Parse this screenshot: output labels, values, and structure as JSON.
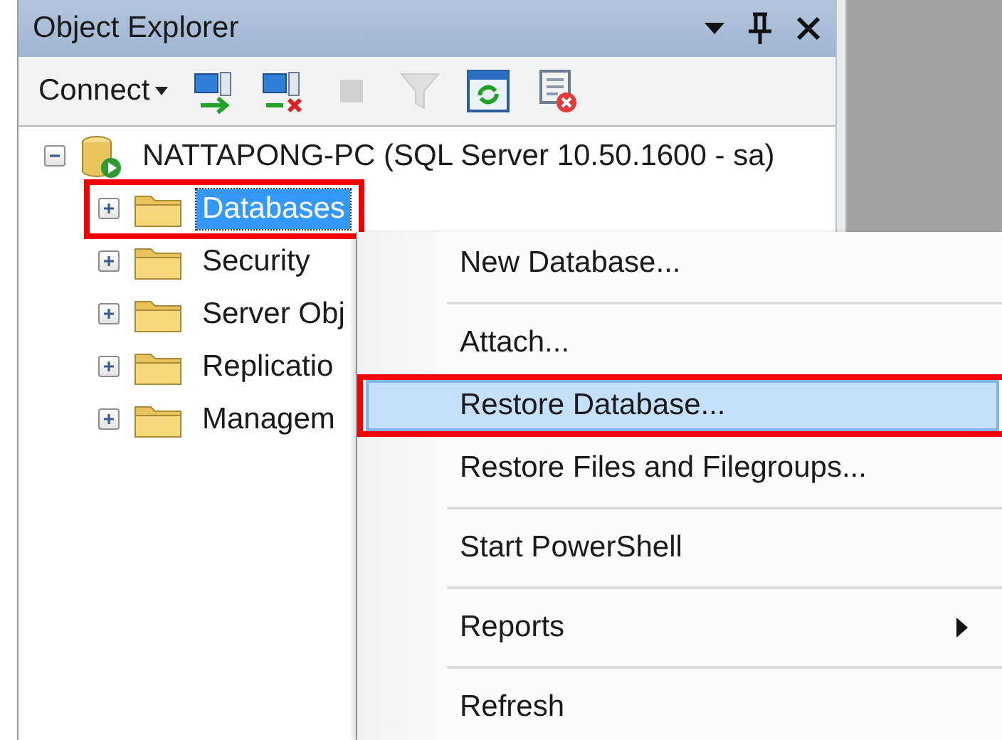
{
  "panel": {
    "title": "Object Explorer"
  },
  "toolbar": {
    "connect": {
      "label": "Connect"
    },
    "buttons": [
      {
        "disabled": false
      },
      {
        "disabled": false
      },
      {
        "disabled": true
      },
      {
        "disabled": true
      },
      {
        "disabled": false
      },
      {
        "disabled": false
      }
    ]
  },
  "tree": {
    "label": "NATTAPONG-PC (SQL Server 10.50.1600 - sa)",
    "expanded": true,
    "children": [
      {
        "label": "Databases",
        "expanded": false,
        "selected": true,
        "highlighted": true
      },
      {
        "label": "Security",
        "expanded": false,
        "selected": false,
        "highlighted": false
      },
      {
        "label": "Server Obj",
        "expanded": false,
        "selected": false,
        "highlighted": false
      },
      {
        "label": "Replicatio",
        "expanded": false,
        "selected": false,
        "highlighted": false
      },
      {
        "label": "Managem",
        "expanded": false,
        "selected": false,
        "highlighted": false
      }
    ]
  },
  "context_menu": {
    "groups": [
      [
        {
          "label": "New Database...",
          "selected": false,
          "highlighted": false,
          "submenu": false
        }
      ],
      [
        {
          "label": "Attach...",
          "selected": false,
          "highlighted": false,
          "submenu": false
        },
        {
          "label": "Restore Database...",
          "selected": true,
          "highlighted": true,
          "submenu": false
        },
        {
          "label": "Restore Files and Filegroups...",
          "selected": false,
          "highlighted": false,
          "submenu": false
        }
      ],
      [
        {
          "label": "Start PowerShell",
          "selected": false,
          "highlighted": false,
          "submenu": false
        }
      ],
      [
        {
          "label": "Reports",
          "selected": false,
          "highlighted": false,
          "submenu": true
        }
      ],
      [
        {
          "label": "Refresh",
          "selected": false,
          "highlighted": false,
          "submenu": false
        }
      ]
    ]
  }
}
